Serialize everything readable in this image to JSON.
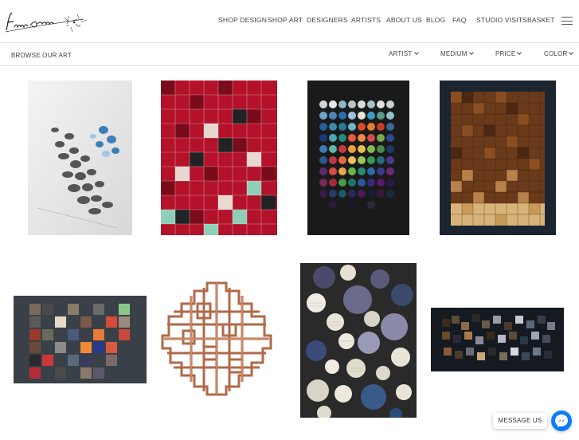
{
  "header": {
    "logo_text": "Fiberlog Canvas",
    "nav": [
      "SHOP DESIGN",
      "SHOP ART",
      "DESIGNERS",
      "ARTISTS",
      "ABOUT US",
      "BLOG",
      "FAQ",
      "STUDIO VISITS",
      "BASKET"
    ]
  },
  "filterbar": {
    "browse_label": "BROWSE OUR ART",
    "filters": [
      "ARTIST",
      "MEDIUM",
      "PRICE",
      "COLOR"
    ]
  },
  "gallery": {
    "items": [
      {
        "name": "art-dark-cylinder-sculpture"
      },
      {
        "name": "art-red-mosaic-tiles"
      },
      {
        "name": "art-colored-spheres"
      },
      {
        "name": "art-wood-block-grid"
      },
      {
        "name": "art-painted-cubes"
      },
      {
        "name": "art-copper-lattice"
      },
      {
        "name": "art-paper-discs"
      },
      {
        "name": "art-dark-wood-blocks"
      }
    ]
  },
  "chat": {
    "message_label": "MESSAGE US"
  },
  "colors": {
    "messenger_blue": "#0a7cff",
    "divider": "#e6e6e6"
  }
}
